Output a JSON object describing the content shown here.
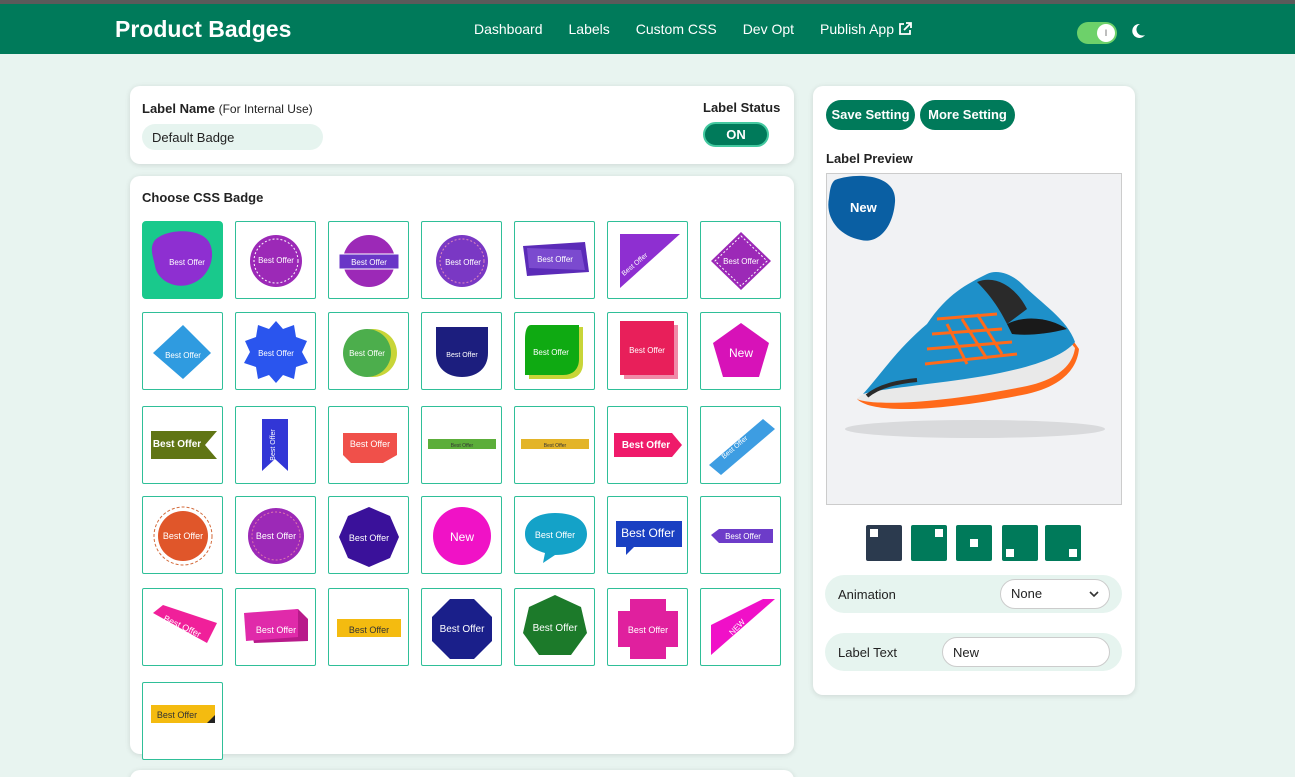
{
  "app": {
    "title": "Product Badges"
  },
  "nav": {
    "items": [
      "Dashboard",
      "Labels",
      "Custom CSS",
      "Dev Opt",
      "Publish App"
    ]
  },
  "header": {
    "toggle_on": true,
    "toggle_text": "I"
  },
  "label_name": {
    "label": "Label Name",
    "hint": "(For Internal Use)",
    "value": "Default Badge"
  },
  "label_status": {
    "label": "Label Status",
    "value": "ON"
  },
  "badges": {
    "heading": "Choose CSS Badge",
    "selected_index": 0,
    "items": [
      "Best Offer",
      "Best Offer",
      "Best Offer",
      "Best Offer",
      "Best Offer",
      "Best Offer",
      "Best Offer",
      "Best Offer",
      "Best Offer",
      "Best Offer",
      "Best Offer",
      "Best Offer",
      "Best Offer",
      "New",
      "Best Offer",
      "Best Offer",
      "Best Offer",
      "Best Offer",
      "Best Offer",
      "Best Offer",
      "Best Offer",
      "Best Offer",
      "Best Offer",
      "Best Offer",
      "New",
      "Best Offer",
      "Best Offer",
      "Best Offer",
      "Best Offer",
      "Best Offer",
      "Best Offer",
      "Best Offer",
      "Best Offer",
      "Best Offer",
      "NEW",
      "Best Offer"
    ]
  },
  "settings": {
    "save_label": "Save Setting",
    "more_label": "More Setting",
    "preview_label": "Label Preview",
    "preview_badge_text": "New",
    "positions": [
      "top-left",
      "top-right",
      "center",
      "bottom-left",
      "bottom-right"
    ],
    "selected_position": 0,
    "animation_label": "Animation",
    "animation_value": "None",
    "label_text_label": "Label Text",
    "label_text_value": "New"
  },
  "colors": {
    "primary": "#007a5a",
    "accent": "#19c98c",
    "background": "#e8f4f0",
    "badge_preview": "#0a5fa3"
  }
}
